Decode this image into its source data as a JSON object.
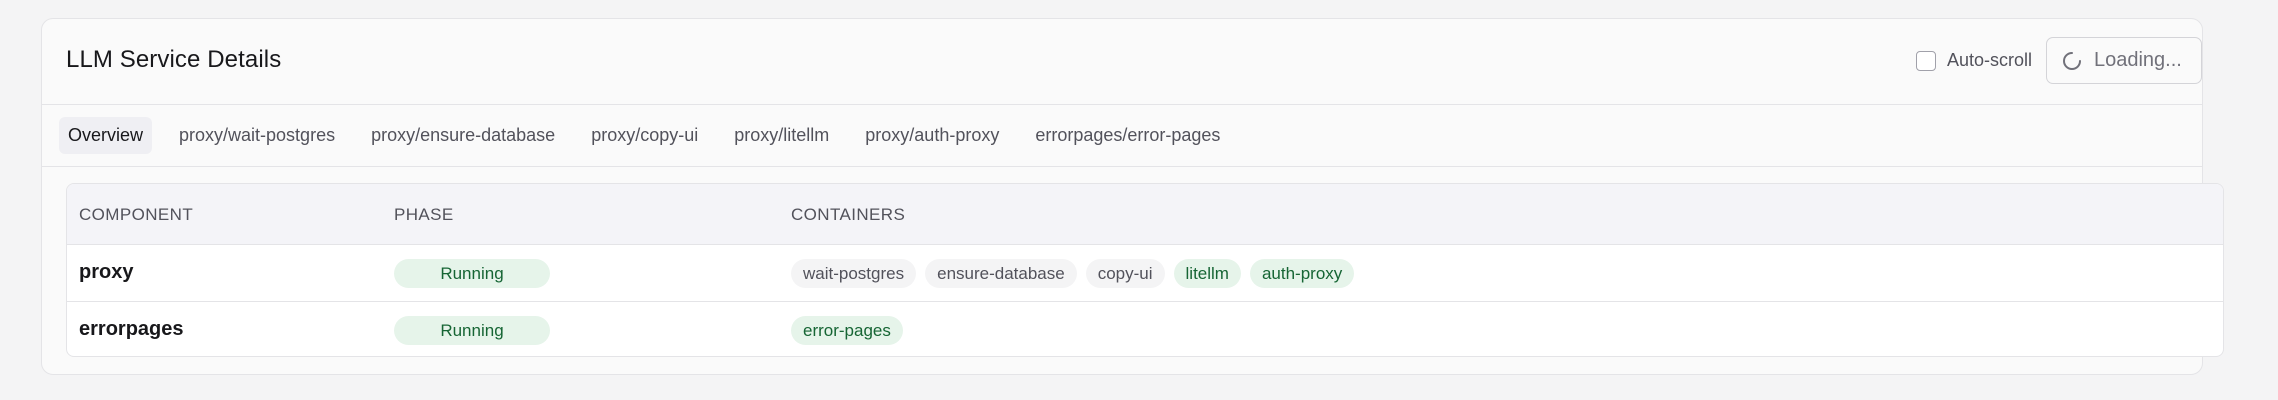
{
  "header": {
    "title": "LLM Service Details",
    "autoscroll_label": "Auto-scroll",
    "autoscroll_checked": false,
    "loading_label": "Loading...",
    "spinner_icon": "spinner-icon"
  },
  "tabs": [
    {
      "label": "Overview",
      "active": true
    },
    {
      "label": "proxy/wait-postgres",
      "active": false
    },
    {
      "label": "proxy/ensure-database",
      "active": false
    },
    {
      "label": "proxy/copy-ui",
      "active": false
    },
    {
      "label": "proxy/litellm",
      "active": false
    },
    {
      "label": "proxy/auth-proxy",
      "active": false
    },
    {
      "label": "errorpages/error-pages",
      "active": false
    }
  ],
  "table": {
    "columns": [
      "COMPONENT",
      "PHASE",
      "CONTAINERS"
    ],
    "rows": [
      {
        "component": "proxy",
        "phase": "Running",
        "containers": [
          {
            "name": "wait-postgres",
            "status": "completed"
          },
          {
            "name": "ensure-database",
            "status": "completed"
          },
          {
            "name": "copy-ui",
            "status": "completed"
          },
          {
            "name": "litellm",
            "status": "running"
          },
          {
            "name": "auth-proxy",
            "status": "running"
          }
        ]
      },
      {
        "component": "errorpages",
        "phase": "Running",
        "containers": [
          {
            "name": "error-pages",
            "status": "running"
          }
        ]
      }
    ]
  },
  "colors": {
    "running_bg": "#e6f4ea",
    "running_text": "#166534",
    "neutral_bg": "#f4f4f5",
    "neutral_text": "#52525b"
  }
}
